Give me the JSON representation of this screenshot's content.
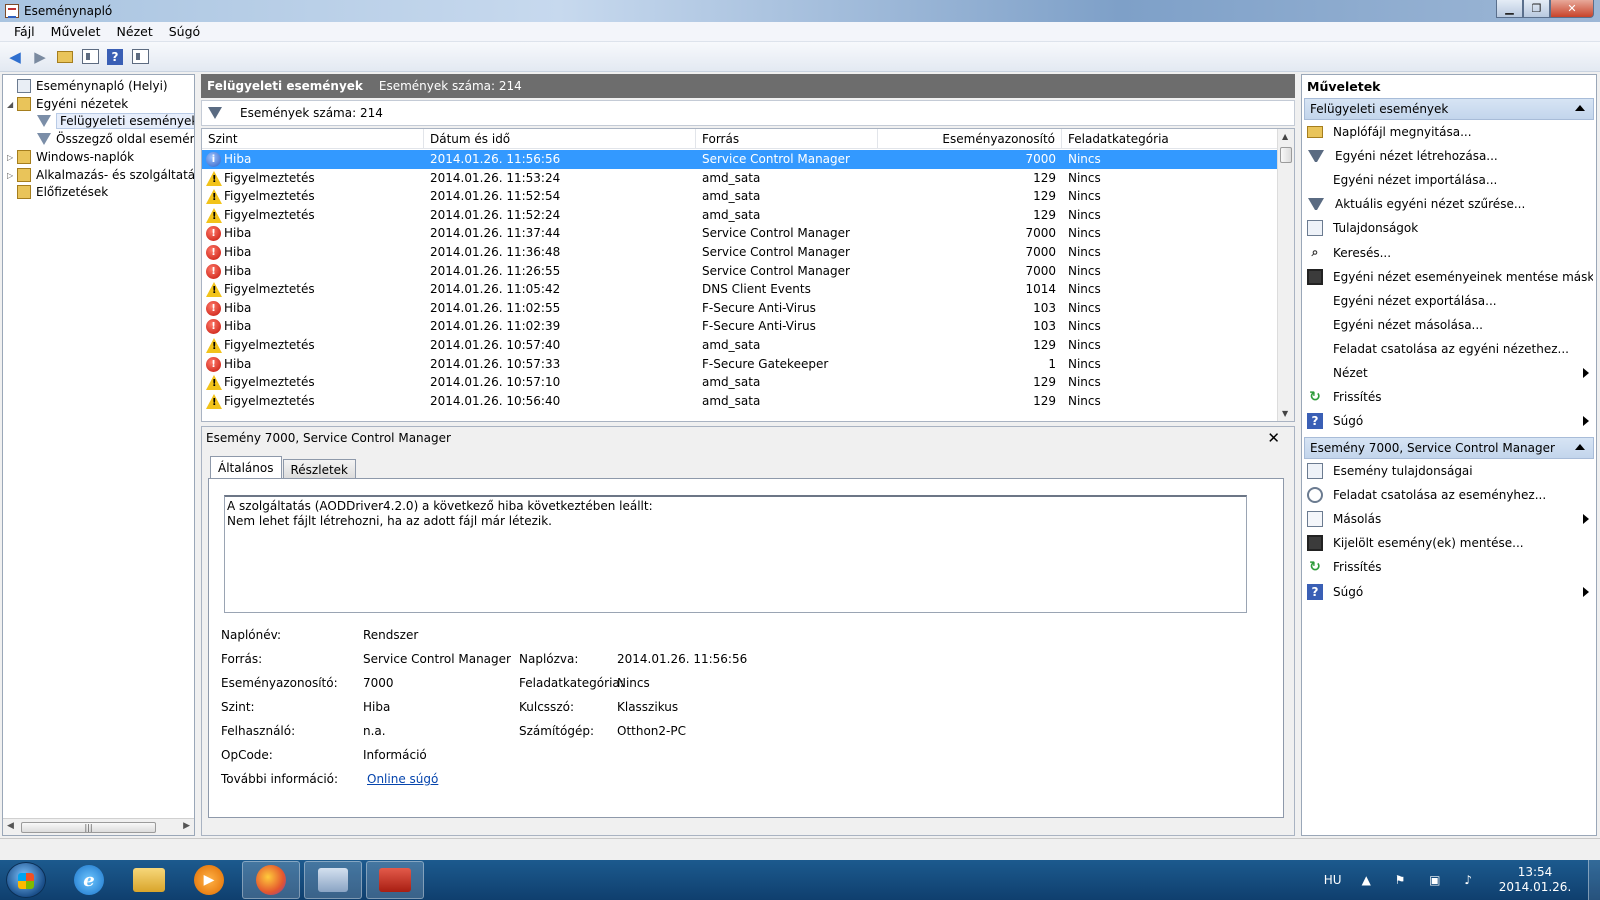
{
  "window": {
    "title": "Eseménynapló"
  },
  "menu": [
    "Fájl",
    "Művelet",
    "Nézet",
    "Súgó"
  ],
  "tree": {
    "root": "Eseménynapló (Helyi)",
    "custom_views": "Egyéni nézetek",
    "admin_events": "Felügyeleti események",
    "summary": "Összegző oldal eseménye",
    "windows_logs": "Windows-naplók",
    "app_logs": "Alkalmazás- és szolgáltatásn",
    "subscriptions": "Előfizetések"
  },
  "center": {
    "header_title": "Felügyeleti események",
    "header_count": "Események száma: 214",
    "filter_count": "Események száma: 214",
    "columns": [
      "Szint",
      "Dátum és idő",
      "Forrás",
      "Eseményazonosító",
      "Feladatkategória"
    ],
    "rows": [
      {
        "level": "Hiba",
        "type": "info",
        "date": "2014.01.26. 11:56:56",
        "source": "Service Control Manager",
        "id": "7000",
        "cat": "Nincs"
      },
      {
        "level": "Figyelmeztetés",
        "type": "warn",
        "date": "2014.01.26. 11:53:24",
        "source": "amd_sata",
        "id": "129",
        "cat": "Nincs"
      },
      {
        "level": "Figyelmeztetés",
        "type": "warn",
        "date": "2014.01.26. 11:52:54",
        "source": "amd_sata",
        "id": "129",
        "cat": "Nincs"
      },
      {
        "level": "Figyelmeztetés",
        "type": "warn",
        "date": "2014.01.26. 11:52:24",
        "source": "amd_sata",
        "id": "129",
        "cat": "Nincs"
      },
      {
        "level": "Hiba",
        "type": "err",
        "date": "2014.01.26. 11:37:44",
        "source": "Service Control Manager",
        "id": "7000",
        "cat": "Nincs"
      },
      {
        "level": "Hiba",
        "type": "err",
        "date": "2014.01.26. 11:36:48",
        "source": "Service Control Manager",
        "id": "7000",
        "cat": "Nincs"
      },
      {
        "level": "Hiba",
        "type": "err",
        "date": "2014.01.26. 11:26:55",
        "source": "Service Control Manager",
        "id": "7000",
        "cat": "Nincs"
      },
      {
        "level": "Figyelmeztetés",
        "type": "warn",
        "date": "2014.01.26. 11:05:42",
        "source": "DNS Client Events",
        "id": "1014",
        "cat": "Nincs"
      },
      {
        "level": "Hiba",
        "type": "err",
        "date": "2014.01.26. 11:02:55",
        "source": "F-Secure Anti-Virus",
        "id": "103",
        "cat": "Nincs"
      },
      {
        "level": "Hiba",
        "type": "err",
        "date": "2014.01.26. 11:02:39",
        "source": "F-Secure Anti-Virus",
        "id": "103",
        "cat": "Nincs"
      },
      {
        "level": "Figyelmeztetés",
        "type": "warn",
        "date": "2014.01.26. 10:57:40",
        "source": "amd_sata",
        "id": "129",
        "cat": "Nincs"
      },
      {
        "level": "Hiba",
        "type": "err",
        "date": "2014.01.26. 10:57:33",
        "source": "F-Secure Gatekeeper",
        "id": "1",
        "cat": "Nincs"
      },
      {
        "level": "Figyelmeztetés",
        "type": "warn",
        "date": "2014.01.26. 10:57:10",
        "source": "amd_sata",
        "id": "129",
        "cat": "Nincs"
      },
      {
        "level": "Figyelmeztetés",
        "type": "warn",
        "date": "2014.01.26. 10:56:40",
        "source": "amd_sata",
        "id": "129",
        "cat": "Nincs"
      }
    ]
  },
  "detail": {
    "title": "Esemény 7000, Service Control Manager",
    "tabs": [
      "Általános",
      "Részletek"
    ],
    "description_line1": "A szolgáltatás (AODDriver4.2.0) a következő hiba következtében leállt:",
    "description_line2": "Nem lehet fájlt létrehozni, ha az adott fájl már létezik.",
    "labels": {
      "log_name": "Naplónév:",
      "source": "Forrás:",
      "event_id": "Eseményazonosító:",
      "level": "Szint:",
      "user": "Felhasználó:",
      "opcode": "OpCode:",
      "more_info": "További információ:",
      "logged": "Naplózva:",
      "task_category": "Feladatkategória:",
      "keywords": "Kulcsszó:",
      "computer": "Számítógép:"
    },
    "values": {
      "log_name": "Rendszer",
      "source": "Service Control Manager",
      "event_id": "7000",
      "level": "Hiba",
      "user": "n.a.",
      "opcode": "Információ",
      "more_info_link": "Online súgó",
      "logged": "2014.01.26. 11:56:56",
      "task_category": "Nincs",
      "keywords": "Klasszikus",
      "computer": "Otthon2-PC"
    }
  },
  "actions": {
    "title": "Műveletek",
    "section1": "Felügyeleti események",
    "items1": [
      {
        "label": "Naplófájl megnyitása...",
        "icon": "folder-icon"
      },
      {
        "label": "Egyéni nézet létrehozása...",
        "icon": "funnel-icon"
      },
      {
        "label": "Egyéni nézet importálása...",
        "icon": ""
      },
      {
        "label": "Aktuális egyéni nézet szűrése...",
        "icon": "funnel-icon"
      },
      {
        "label": "Tulajdonságok",
        "icon": "properties-icon"
      },
      {
        "label": "Keresés...",
        "icon": "find-icon"
      },
      {
        "label": "Egyéni nézet eseményeinek mentése máské...",
        "icon": "save-icon"
      },
      {
        "label": "Egyéni nézet exportálása...",
        "icon": ""
      },
      {
        "label": "Egyéni nézet másolása...",
        "icon": ""
      },
      {
        "label": "Feladat csatolása az egyéni nézethez...",
        "icon": ""
      },
      {
        "label": "Nézet",
        "icon": "",
        "submenu": true
      },
      {
        "label": "Frissítés",
        "icon": "refresh-icon"
      },
      {
        "label": "Súgó",
        "icon": "help-icon",
        "submenu": true
      }
    ],
    "section2": "Esemény 7000, Service Control Manager",
    "items2": [
      {
        "label": "Esemény tulajdonságai",
        "icon": "properties-icon"
      },
      {
        "label": "Feladat csatolása az eseményhez...",
        "icon": "clock-icon"
      },
      {
        "label": "Másolás",
        "icon": "copy-icon",
        "submenu": true
      },
      {
        "label": "Kijelölt esemény(ek) mentése...",
        "icon": "save-icon"
      },
      {
        "label": "Frissítés",
        "icon": "refresh-icon"
      },
      {
        "label": "Súgó",
        "icon": "help-icon",
        "submenu": true
      }
    ]
  },
  "taskbar": {
    "ie_glyph": "e",
    "media_glyph": "▶",
    "lang": "HU",
    "tray_icons": "▲ ⚑ ▣ ♪",
    "time": "13:54",
    "date": "2014.01.26."
  }
}
